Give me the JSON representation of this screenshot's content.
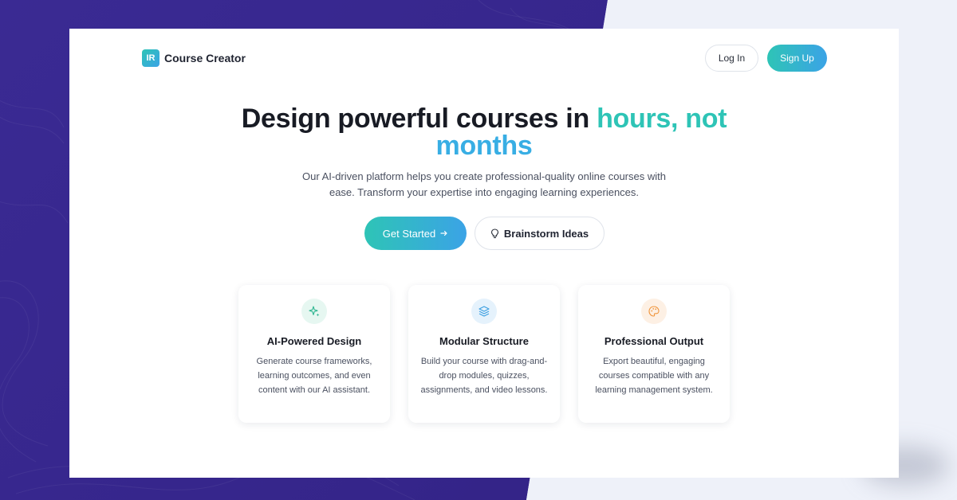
{
  "brand": {
    "badge": "IR",
    "name": "Course Creator"
  },
  "nav": {
    "login_label": "Log In",
    "signup_label": "Sign Up"
  },
  "hero": {
    "title_main": "Design powerful courses in ",
    "title_accent_1": "hours, not",
    "title_accent_2": "months",
    "subtitle": "Our AI-driven platform helps you create professional-quality online courses with ease. Transform your expertise into engaging learning experiences.",
    "primary_cta": "Get Started",
    "primary_cta_icon": "arrow-right-icon",
    "secondary_cta": "Brainstorm Ideas",
    "secondary_cta_icon": "lightbulb-icon"
  },
  "features": [
    {
      "icon": "sparkles-icon",
      "title": "AI-Powered Design",
      "description": "Generate course frameworks, learning outcomes, and even content with our AI assistant."
    },
    {
      "icon": "layers-icon",
      "title": "Modular Structure",
      "description": "Build your course with drag-and-drop modules, quizzes, assignments, and video lessons."
    },
    {
      "icon": "palette-icon",
      "title": "Professional Output",
      "description": "Export beautiful, engaging courses compatible with any learning management system."
    }
  ],
  "colors": {
    "accent_teal": "#2ec4b6",
    "accent_blue": "#38aee4",
    "background_purple": "#3a2a93",
    "background_light": "#eef1f9"
  }
}
